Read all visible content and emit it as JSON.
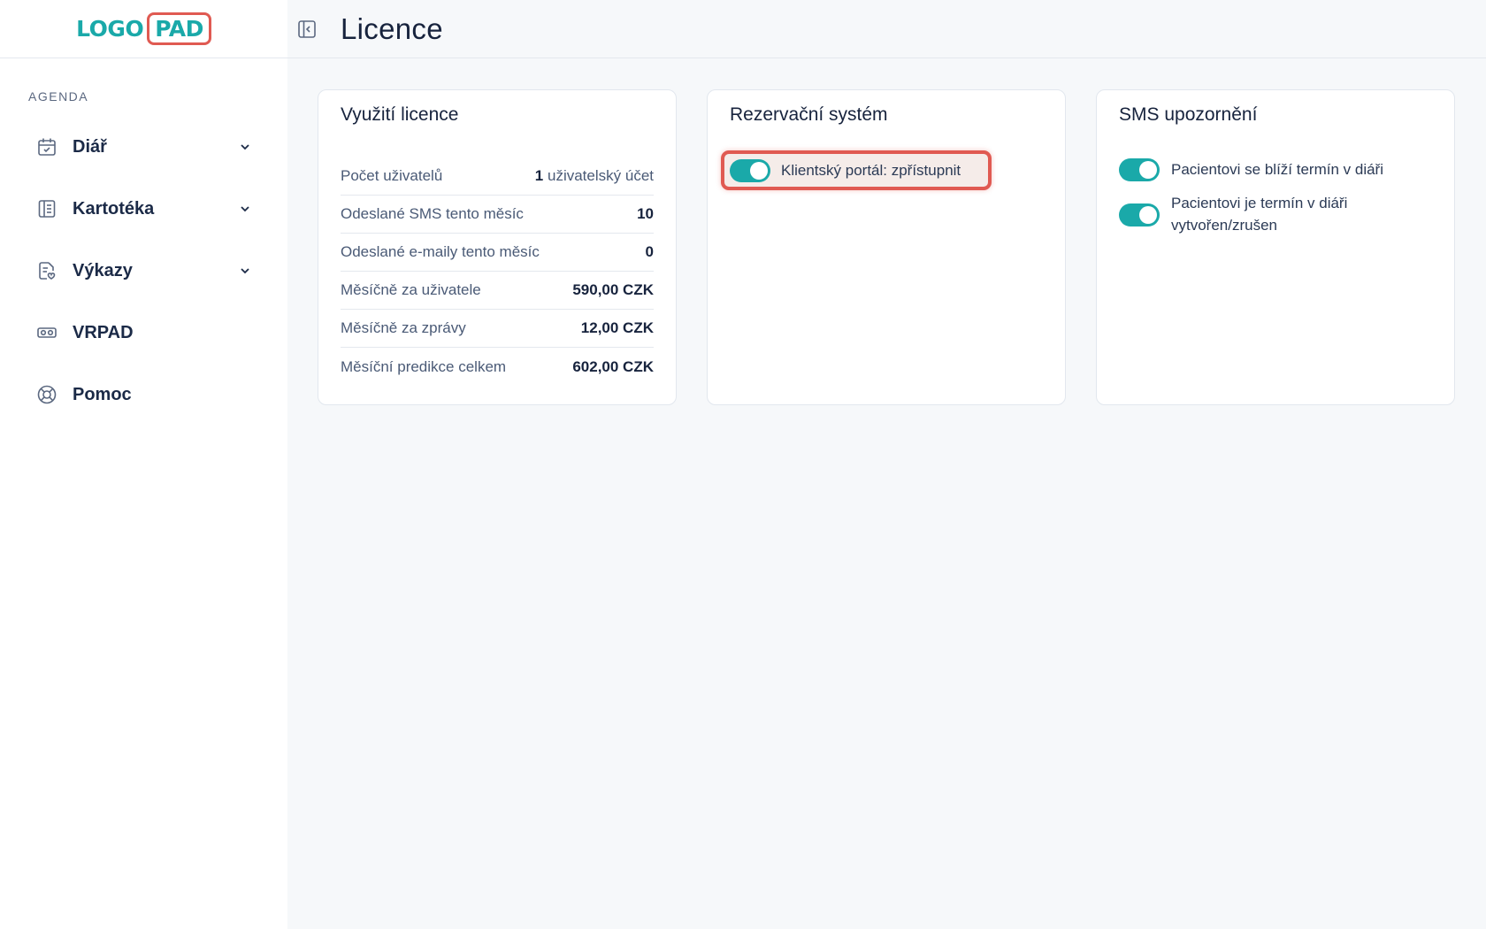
{
  "logo": {
    "part1": "LOGO",
    "part2": "PAD"
  },
  "sidebar": {
    "section_label": "AGENDA",
    "items": [
      {
        "label": "Diář",
        "icon": "calendar-check-icon",
        "has_chevron": true
      },
      {
        "label": "Kartotéka",
        "icon": "notebook-icon",
        "has_chevron": true
      },
      {
        "label": "Výkazy",
        "icon": "report-icon",
        "has_chevron": true
      },
      {
        "label": "VRPAD",
        "icon": "vr-headset-icon",
        "has_chevron": false
      },
      {
        "label": "Pomoc",
        "icon": "lifebuoy-icon",
        "has_chevron": false
      }
    ]
  },
  "header": {
    "title": "Licence",
    "collapse_icon": "sidebar-collapse-icon"
  },
  "license_card": {
    "title": "Využití licence",
    "rows": [
      {
        "key": "Počet uživatelů",
        "value": "1",
        "unit": "uživatelský účet"
      },
      {
        "key": "Odeslané SMS tento měsíc",
        "value": "10",
        "unit": ""
      },
      {
        "key": "Odeslané e-maily tento měsíc",
        "value": "0",
        "unit": ""
      },
      {
        "key": "Měsíčně za uživatele",
        "value": "590,00 CZK",
        "unit": ""
      },
      {
        "key": "Měsíčně za zprávy",
        "value": "12,00 CZK",
        "unit": ""
      },
      {
        "key": "Měsíční predikce celkem",
        "value": "602,00 CZK",
        "unit": ""
      }
    ]
  },
  "reservation_card": {
    "title": "Rezervační systém",
    "toggle_label": "Klientský portál: zpřístupnit",
    "toggle_on": true
  },
  "sms_card": {
    "title": "SMS upozornění",
    "toggles": [
      {
        "label": "Pacientovi se blíží termín v diáři",
        "on": true
      },
      {
        "label": "Pacientovi je termín v diáři vytvořen/zrušen",
        "on": true
      }
    ]
  },
  "colors": {
    "accent": "#1aa9a9",
    "highlight": "#e05a52",
    "text": "#17233d"
  }
}
